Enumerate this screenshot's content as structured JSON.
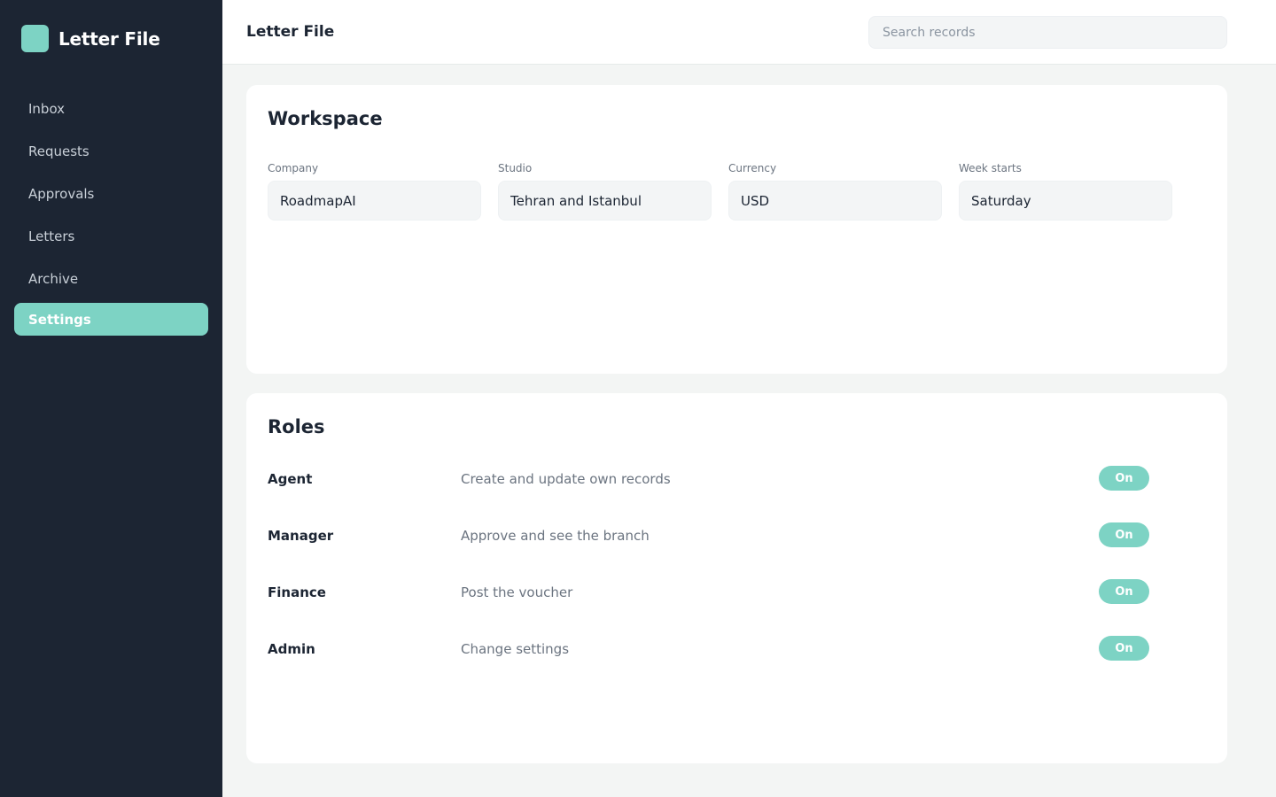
{
  "app": {
    "name": "Letter File",
    "accent": "#7dd3c4",
    "sidebar_bg": "#1c2533"
  },
  "sidebar": {
    "items": [
      {
        "label": "Inbox",
        "active": false
      },
      {
        "label": "Requests",
        "active": false
      },
      {
        "label": "Approvals",
        "active": false
      },
      {
        "label": "Letters",
        "active": false
      },
      {
        "label": "Archive",
        "active": false
      },
      {
        "label": "Settings",
        "active": true
      }
    ]
  },
  "header": {
    "title": "Letter File",
    "search_placeholder": "Search records"
  },
  "workspace": {
    "title": "Workspace",
    "fields": [
      {
        "label": "Company",
        "value": "RoadmapAI"
      },
      {
        "label": "Studio",
        "value": "Tehran and Istanbul"
      },
      {
        "label": "Currency",
        "value": "USD"
      },
      {
        "label": "Week starts",
        "value": "Saturday"
      }
    ]
  },
  "roles": {
    "title": "Roles",
    "items": [
      {
        "name": "Agent",
        "description": "Create and update own records",
        "toggle": "On"
      },
      {
        "name": "Manager",
        "description": "Approve and see the branch",
        "toggle": "On"
      },
      {
        "name": "Finance",
        "description": "Post the voucher",
        "toggle": "On"
      },
      {
        "name": "Admin",
        "description": "Change settings",
        "toggle": "On"
      }
    ]
  }
}
